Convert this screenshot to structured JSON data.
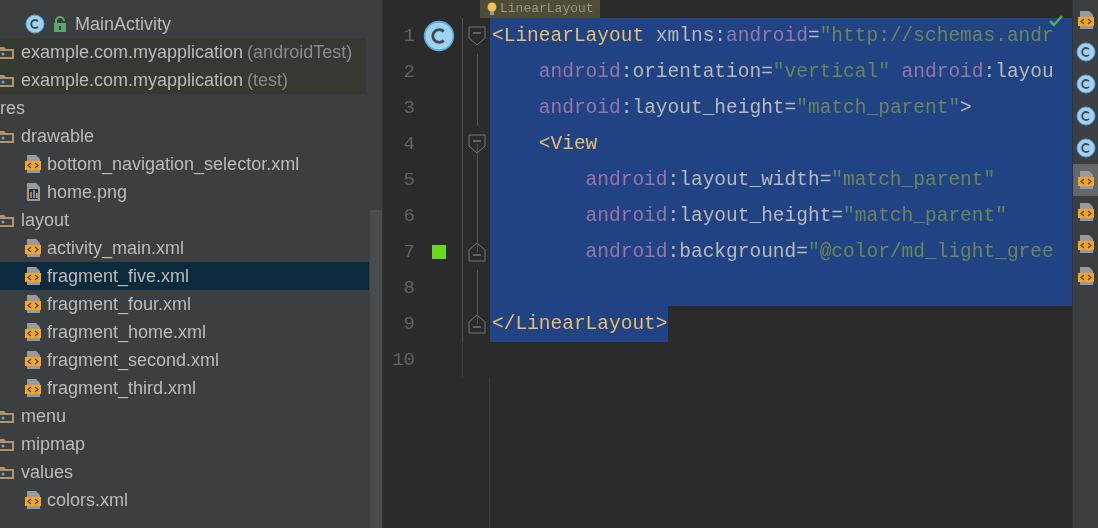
{
  "sidebar": {
    "classes": [
      {
        "label": "MainActivity",
        "kind": "class",
        "locked": true,
        "selected": false
      }
    ],
    "packages": [
      {
        "label": "example.com.myapplication",
        "suffix": "(androidTest)",
        "kind": "package",
        "selected": false
      },
      {
        "label": "example.com.myapplication",
        "suffix": "(test)",
        "kind": "package",
        "selected": false
      }
    ],
    "resources": {
      "label": "res",
      "selected": false,
      "children": [
        {
          "label": "drawable",
          "kind": "folder",
          "selected": false,
          "children": [
            {
              "label": "bottom_navigation_selector.xml",
              "kind": "xml",
              "selected": false
            },
            {
              "label": "home.png",
              "kind": "png",
              "selected": false
            }
          ]
        },
        {
          "label": "layout",
          "kind": "folder",
          "selected": false,
          "children": [
            {
              "label": "activity_main.xml",
              "kind": "xml",
              "selected": false
            },
            {
              "label": "fragment_five.xml",
              "kind": "xml",
              "selected": true
            },
            {
              "label": "fragment_four.xml",
              "kind": "xml",
              "selected": false
            },
            {
              "label": "fragment_home.xml",
              "kind": "xml",
              "selected": false
            },
            {
              "label": "fragment_second.xml",
              "kind": "xml",
              "selected": false
            },
            {
              "label": "fragment_third.xml",
              "kind": "xml",
              "selected": false
            }
          ]
        },
        {
          "label": "menu",
          "kind": "folder",
          "selected": false
        },
        {
          "label": "mipmap",
          "kind": "folder",
          "selected": false
        },
        {
          "label": "values",
          "kind": "folder",
          "selected": false,
          "children": [
            {
              "label": "colors.xml",
              "kind": "xml",
              "selected": false
            }
          ]
        }
      ]
    }
  },
  "editor": {
    "breadcrumb": "LinearLayout",
    "lines": [
      {
        "number": "1",
        "selected": true,
        "class_marker": true,
        "fold_start": true,
        "fold_end": false,
        "tokens": [
          {
            "kind": "tag",
            "text": "<LinearLayout"
          },
          {
            "kind": "attr",
            "text": " xmlns:"
          },
          {
            "kind": "ns",
            "text": "android"
          },
          {
            "kind": "attr",
            "text": "="
          },
          {
            "kind": "value",
            "text": "\"http://schemas.andr"
          }
        ]
      },
      {
        "number": "2",
        "selected": true,
        "class_marker": false,
        "fold_start": false,
        "fold_end": false,
        "tokens": [
          {
            "kind": "ns",
            "text": "    android"
          },
          {
            "kind": "attr",
            "text": ":orientation="
          },
          {
            "kind": "value",
            "text": "\"vertical\""
          },
          {
            "kind": "ns",
            "text": " android"
          },
          {
            "kind": "attr",
            "text": ":layou"
          }
        ]
      },
      {
        "number": "3",
        "selected": true,
        "class_marker": false,
        "fold_start": false,
        "fold_end": false,
        "tokens": [
          {
            "kind": "ns",
            "text": "    android"
          },
          {
            "kind": "attr",
            "text": ":layout_height="
          },
          {
            "kind": "value",
            "text": "\"match_parent\""
          },
          {
            "kind": "attr",
            "text": ">"
          }
        ]
      },
      {
        "number": "4",
        "selected": true,
        "class_marker": false,
        "fold_start": true,
        "fold_end": false,
        "tokens": [
          {
            "kind": "tag",
            "text": "    <View"
          }
        ]
      },
      {
        "number": "5",
        "selected": true,
        "class_marker": false,
        "fold_start": false,
        "fold_end": false,
        "tokens": [
          {
            "kind": "ns",
            "text": "        android"
          },
          {
            "kind": "attr",
            "text": ":layout_width="
          },
          {
            "kind": "value",
            "text": "\"match_parent\""
          }
        ]
      },
      {
        "number": "6",
        "selected": true,
        "class_marker": false,
        "fold_start": false,
        "fold_end": false,
        "tokens": [
          {
            "kind": "ns",
            "text": "        android"
          },
          {
            "kind": "attr",
            "text": ":layout_height="
          },
          {
            "kind": "value",
            "text": "\"match_parent\""
          }
        ]
      },
      {
        "number": "7",
        "selected": true,
        "class_marker": false,
        "color": "#66d91a",
        "fold_start": false,
        "fold_end": true,
        "tokens": [
          {
            "kind": "ns",
            "text": "        android"
          },
          {
            "kind": "attr",
            "text": ":background="
          },
          {
            "kind": "value",
            "text": "\"@color/md_light_gree"
          }
        ]
      },
      {
        "number": "8",
        "selected": true,
        "class_marker": false,
        "fold_start": false,
        "fold_end": false
      },
      {
        "number": "9",
        "selected": true,
        "class_marker": false,
        "fold_start": false,
        "fold_end": true,
        "tokens": [
          {
            "kind": "tag",
            "text": "</LinearLayout>"
          }
        ]
      },
      {
        "number": "10",
        "selected": false,
        "class_marker": false,
        "fold_start": false,
        "fold_end": false
      }
    ]
  },
  "file_strip": [
    {
      "kind": "xml",
      "selected": false
    },
    {
      "kind": "class",
      "selected": false
    },
    {
      "kind": "class",
      "selected": false
    },
    {
      "kind": "class",
      "selected": false
    },
    {
      "kind": "class",
      "selected": false
    },
    {
      "kind": "xml",
      "selected": true
    },
    {
      "kind": "xml",
      "selected": false
    },
    {
      "kind": "xml",
      "selected": false
    },
    {
      "kind": "xml",
      "selected": false
    }
  ]
}
